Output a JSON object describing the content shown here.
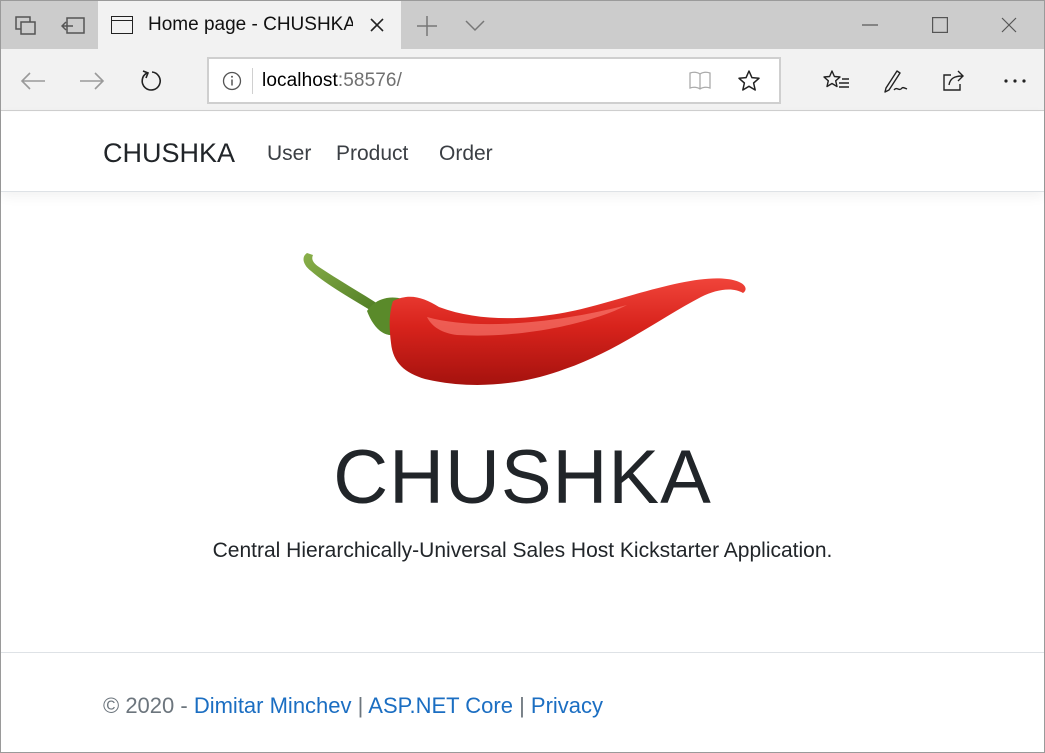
{
  "browser": {
    "tab_title": "Home page - CHUSHKA",
    "url_host": "localhost",
    "url_port": ":58576/"
  },
  "site": {
    "brand": "CHUSHKA",
    "nav": [
      {
        "label": "User"
      },
      {
        "label": "Product"
      },
      {
        "label": "Order"
      }
    ],
    "hero_title": "CHUSHKA",
    "hero_subtitle": "Central Hierarchically-Universal Sales Host Kickstarter Application.",
    "footer": {
      "copyright": "© 2020 - ",
      "author": "Dimitar Minchev",
      "sep1": " | ",
      "framework": "ASP.NET Core",
      "sep2": " | ",
      "privacy": "Privacy"
    }
  },
  "colors": {
    "link": "#1b6ec2",
    "pepper": "#d8231c",
    "stem": "#5a8a2a"
  }
}
